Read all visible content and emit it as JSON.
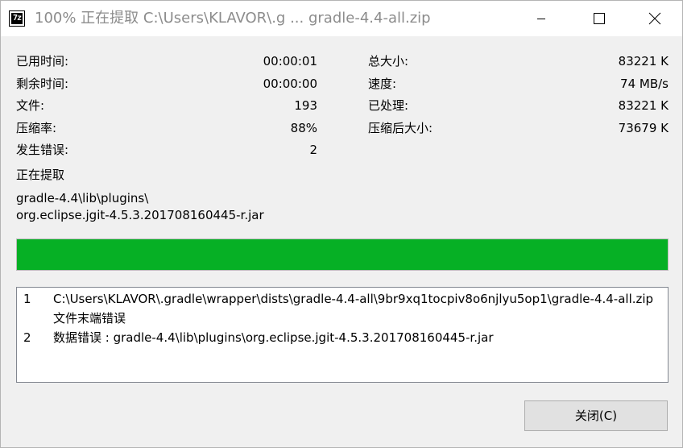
{
  "window": {
    "title": "100% 正在提取 C:\\Users\\KLAVOR\\.g ... gradle-4.4-all.zip",
    "icon_text": "7z"
  },
  "stats_left": [
    {
      "label": "已用时间:",
      "value": "00:00:01"
    },
    {
      "label": "剩余时间:",
      "value": "00:00:00"
    },
    {
      "label": "文件:",
      "value": "193"
    },
    {
      "label": "压缩率:",
      "value": "88%"
    },
    {
      "label": "发生错误:",
      "value": "2"
    }
  ],
  "stats_right": [
    {
      "label": "总大小:",
      "value": "83221 K"
    },
    {
      "label": "速度:",
      "value": "74 MB/s"
    },
    {
      "label": "已处理:",
      "value": "83221 K"
    },
    {
      "label": "压缩后大小:",
      "value": "73679 K"
    }
  ],
  "status": {
    "label": "正在提取",
    "path_line1": "gradle-4.4\\lib\\plugins\\",
    "path_line2": "org.eclipse.jgit-4.5.3.201708160445-r.jar"
  },
  "progress": {
    "percent": 100,
    "color": "#06b025"
  },
  "errors": [
    {
      "num": "1",
      "line1": "C:\\Users\\KLAVOR\\.gradle\\wrapper\\dists\\gradle-4.4-all\\9br9xq1tocpiv8o6njlyu5op1\\gradle-4.4-all.zip",
      "line2": "文件末端错误"
    },
    {
      "num": "2",
      "line1": "数据错误 : gradle-4.4\\lib\\plugins\\org.eclipse.jgit-4.5.3.201708160445-r.jar"
    }
  ],
  "buttons": {
    "close_label": "关闭(C)"
  },
  "icons": {
    "minimize": "minimize-icon",
    "maximize": "maximize-icon",
    "close": "close-icon"
  }
}
